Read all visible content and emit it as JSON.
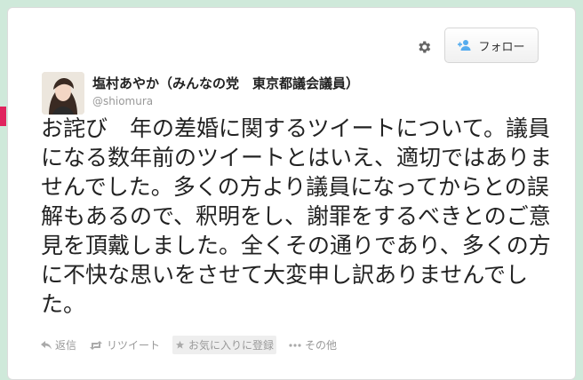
{
  "profile": {
    "name": "塩村あやか（みんなの党　東京都議会議員）",
    "handle": "@shiomura"
  },
  "header": {
    "follow_label": "フォロー",
    "icons": {
      "settings": "gear-icon",
      "follow": "add-user-icon"
    }
  },
  "tweet": {
    "text": "お詫び　年の差婚に関するツイートについて。議員になる数年前のツイートとはいえ、適切ではありませんでした。多くの方より議員になってからとの誤解もあるので、釈明をし、謝罪をするべきとのご意見を頂戴しました。全くその通りであり、多くの方に不快な思いをさせて大変申し訳ありませんでした。"
  },
  "actions": {
    "reply": "返信",
    "retweet": "リツイート",
    "favorite": "お気に入りに登録",
    "more": "その他"
  },
  "colors": {
    "background": "#cfe9da",
    "text": "#222222",
    "muted": "#999999",
    "accent": "#e0245e"
  }
}
